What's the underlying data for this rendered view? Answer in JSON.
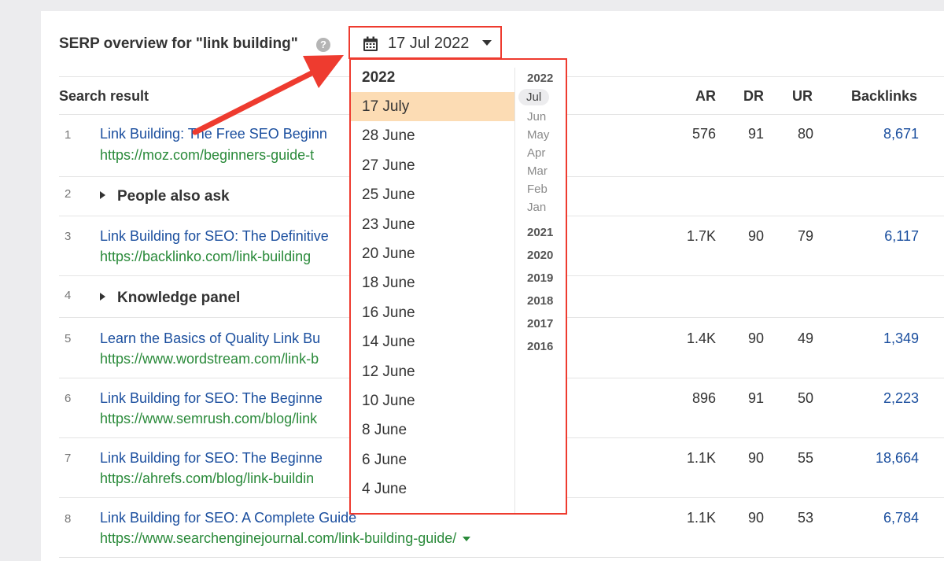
{
  "header": {
    "title": "SERP overview for \"link building\"",
    "help": "?",
    "date_button": "17 Jul 2022"
  },
  "table": {
    "columns": [
      "Search result",
      "AR",
      "DR",
      "UR",
      "Backlinks"
    ],
    "rows": [
      {
        "n": "1",
        "title": "Link Building: The Free SEO Beginn",
        "url": "https://moz.com/beginners-guide-t",
        "ar": "576",
        "dr": "91",
        "ur": "80",
        "bl": "8,671"
      },
      {
        "n": "2",
        "feature": "People also ask"
      },
      {
        "n": "3",
        "title": "Link Building for SEO: The Definitive",
        "url": "https://backlinko.com/link-building",
        "ar": "1.7K",
        "dr": "90",
        "ur": "79",
        "bl": "6,117"
      },
      {
        "n": "4",
        "feature": "Knowledge panel"
      },
      {
        "n": "5",
        "title": "Learn the Basics of Quality Link Bu",
        "url": "https://www.wordstream.com/link-b",
        "ar": "1.4K",
        "dr": "90",
        "ur": "49",
        "bl": "1,349"
      },
      {
        "n": "6",
        "title": "Link Building for SEO: The Beginne",
        "url": "https://www.semrush.com/blog/link",
        "ar": "896",
        "dr": "91",
        "ur": "50",
        "bl": "2,223"
      },
      {
        "n": "7",
        "title": "Link Building for SEO: The Beginne",
        "url": "https://ahrefs.com/blog/link-buildin",
        "ar": "1.1K",
        "dr": "90",
        "ur": "55",
        "bl": "18,664"
      },
      {
        "n": "8",
        "title": "Link Building for SEO: A Complete Guide",
        "url": "https://www.searchenginejournal.com/link-building-guide/",
        "ar": "1.1K",
        "dr": "90",
        "ur": "53",
        "bl": "6,784"
      }
    ]
  },
  "dropdown": {
    "year": "2022",
    "dates": [
      "17 July",
      "28 June",
      "27 June",
      "25 June",
      "23 June",
      "20 June",
      "18 June",
      "16 June",
      "14 June",
      "12 June",
      "10 June",
      "8 June",
      "6 June",
      "4 June"
    ],
    "selected_index": 0,
    "right_year": "2022",
    "months": [
      "Jul",
      "Jun",
      "May",
      "Apr",
      "Mar",
      "Feb",
      "Jan"
    ],
    "years": [
      "2021",
      "2020",
      "2019",
      "2018",
      "2017",
      "2016"
    ]
  },
  "colors": {
    "highlight": "#ee3b2f",
    "selected_bg": "#fcdcb4",
    "link": "#1a4e9e",
    "url": "#2a8a3a"
  }
}
